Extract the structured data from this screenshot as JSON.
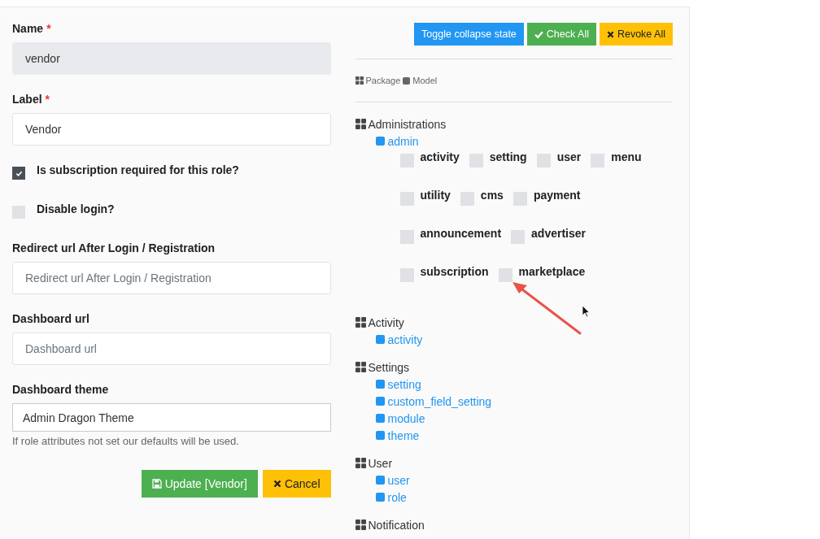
{
  "form": {
    "fields": [
      {
        "kind": "text",
        "label": "Name",
        "required_mark": "*",
        "value": "vendor",
        "disabled": true
      },
      {
        "kind": "text",
        "label": "Label",
        "required_mark": "*",
        "value": "Vendor",
        "disabled": false
      },
      {
        "kind": "checkbox",
        "label": "Is subscription required for this role?",
        "checked": true
      },
      {
        "kind": "checkbox",
        "label": "Disable login?",
        "checked": false
      },
      {
        "kind": "text",
        "label": "Redirect url After Login / Registration",
        "placeholder": "Redirect url After Login / Registration",
        "disabled": false
      },
      {
        "kind": "text",
        "label": "Dashboard url",
        "placeholder": "Dashboard url",
        "disabled": false
      },
      {
        "kind": "select",
        "label": "Dashboard theme",
        "value": "Admin Dragon Theme",
        "help": "If role attributes not set our defaults will be used."
      }
    ],
    "buttons": [
      {
        "kind": "update",
        "label": "Update [Vendor]"
      },
      {
        "kind": "cancel",
        "label": "Cancel"
      }
    ]
  },
  "permissions": {
    "toolbar": [
      {
        "kind": "toggle",
        "label": "Toggle collapse state"
      },
      {
        "kind": "check",
        "label": "Check All"
      },
      {
        "kind": "revoke",
        "label": "Revoke All"
      }
    ],
    "legend": {
      "package": "Package",
      "model": "Model"
    },
    "packages": [
      {
        "name": "Administrations",
        "models": [
          {
            "name": "admin",
            "permission_rows": [
              [
                {
                  "name": "activity",
                  "checked": false
                },
                {
                  "name": "setting",
                  "checked": false
                },
                {
                  "name": "user",
                  "checked": false
                },
                {
                  "name": "menu",
                  "checked": false
                }
              ],
              [
                {
                  "name": "utility",
                  "checked": false
                },
                {
                  "name": "cms",
                  "checked": false
                },
                {
                  "name": "payment",
                  "checked": false
                }
              ],
              [
                {
                  "name": "announcement",
                  "checked": false
                },
                {
                  "name": "advertiser",
                  "checked": false
                }
              ],
              [
                {
                  "name": "subscription",
                  "checked": false
                },
                {
                  "name": "marketplace",
                  "checked": false
                }
              ]
            ]
          }
        ]
      },
      {
        "name": "Activity",
        "models": [
          {
            "name": "activity"
          }
        ]
      },
      {
        "name": "Settings",
        "models": [
          {
            "name": "setting"
          },
          {
            "name": "custom_field_setting"
          },
          {
            "name": "module"
          },
          {
            "name": "theme"
          }
        ]
      },
      {
        "name": "User",
        "models": [
          {
            "name": "user"
          },
          {
            "name": "role"
          }
        ]
      },
      {
        "name": "Notification"
      }
    ]
  }
}
